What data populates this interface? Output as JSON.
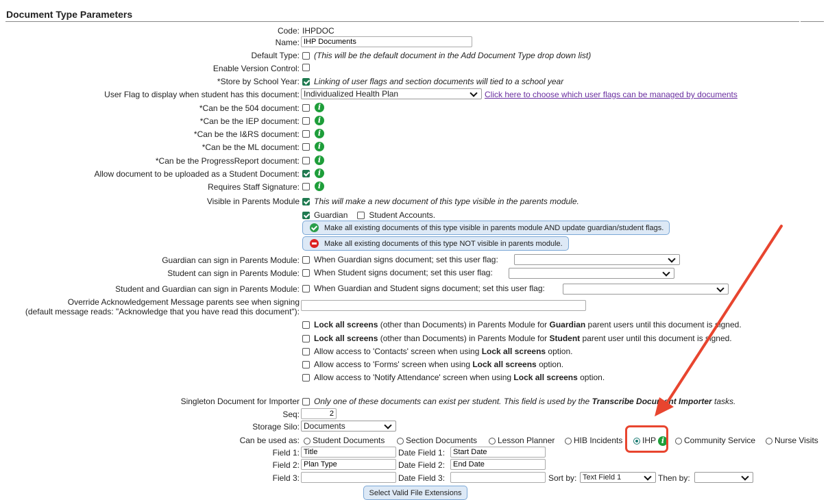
{
  "page": {
    "title": "Document Type Parameters"
  },
  "fields": {
    "code_label": "Code:",
    "code_value": "IHPDOC",
    "name_label": "Name:",
    "name_value": "IHP Documents",
    "default_type_label": "Default Type:",
    "default_type_note": "(This will be the default document in the Add Document Type drop down list)",
    "version_control_label": "Enable Version Control:",
    "store_by_year_label": "*Store by School Year:",
    "store_by_year_note": "Linking of user flags and section documents will tied to a school year",
    "user_flag_label": "User Flag to display when student has this document:",
    "user_flag_value": "Individualized Health Plan",
    "user_flag_link": "Click here to choose which user flags can be managed by documents",
    "can_504_label": "*Can be the 504 document:",
    "can_iep_label": "*Can be the IEP document:",
    "can_irs_label": "*Can be the I&RS document:",
    "can_ml_label": "*Can be the ML document:",
    "can_progress_label": "*Can be the ProgressReport document:",
    "allow_student_doc_label": "Allow document to be uploaded as a Student Document:",
    "requires_staff_sig_label": "Requires Staff Signature:",
    "visible_parents_label": "Visible in Parents Module",
    "visible_parents_note": "This will make a new document of this type visible in the parents module.",
    "guardian_label": "Guardian",
    "student_accounts_label": "Student Accounts.",
    "make_visible_btn": "Make all existing documents of this type visible in parents module AND update guardian/student flags.",
    "make_not_visible_btn": "Make all existing documents of this type NOT visible in parents module.",
    "guardian_sign_label": "Guardian can sign in Parents Module:",
    "guardian_sign_note": "When Guardian signs document; set this user flag:",
    "student_sign_label": "Student can sign in Parents Module:",
    "student_sign_note": "When Student signs document; set this user flag:",
    "both_sign_label": "Student and Guardian can sign in Parents Module:",
    "both_sign_note": "When Guardian and Student signs document; set this user flag:",
    "override_ack_label_1": "Override Acknowledgement Message parents see when signing",
    "override_ack_label_2": "(default message reads: \"Acknowledge that you have read this document\"):",
    "lock_guardian_pre": "Lock all screens",
    "lock_guardian_mid": " (other than Documents) in Parents Module for ",
    "lock_guardian_role": "Guardian",
    "lock_guardian_post": " parent users until this document is signed.",
    "lock_student_pre": "Lock all screens",
    "lock_student_mid": " (other than Documents) in Parents Module for ",
    "lock_student_role": "Student",
    "lock_student_post": " parent user until this document is signed.",
    "contacts_pre": "Allow access to 'Contacts' screen when using ",
    "forms_pre": "Allow access to 'Forms' screen when using ",
    "notify_pre": "Allow access to 'Notify Attendance' screen when using ",
    "lock_all_bold": "Lock all screens",
    "option_suffix": " option.",
    "singleton_label": "Singleton Document for Importer",
    "singleton_note_pre": "Only one of these documents can exist per student. This field is used by the ",
    "singleton_note_bold": "Transcribe Document Importer",
    "singleton_note_post": " tasks.",
    "seq_label": "Seq:",
    "seq_value": "2",
    "storage_label": "Storage Silo:",
    "storage_value": "Documents",
    "can_be_used_label": "Can be used as:",
    "used_as_options": [
      "Student Documents",
      "Section Documents",
      "Lesson Planner",
      "HIB Incidents",
      "IHP",
      "Community Service",
      "Nurse Visits"
    ],
    "field1_label": "Field 1:",
    "field1_value": "Title",
    "field2_label": "Field 2:",
    "field2_value": "Plan Type",
    "field3_label": "Field 3:",
    "field3_value": "",
    "date1_label": "Date Field 1:",
    "date1_value": "Start Date",
    "date2_label": "Date Field 2:",
    "date2_value": "End Date",
    "date3_label": "Date Field 3:",
    "date3_value": "",
    "sort_by_label": "Sort by:",
    "sort_by_value": "Text Field 1",
    "then_by_label": "Then by:",
    "then_by_value": "",
    "file_ext_btn": "Select Valid File Extensions"
  },
  "colors": {
    "accent": "#1f7a50",
    "info": "#1e9e3a",
    "highlight": "#e8452f",
    "link": "#6a2fa0"
  }
}
